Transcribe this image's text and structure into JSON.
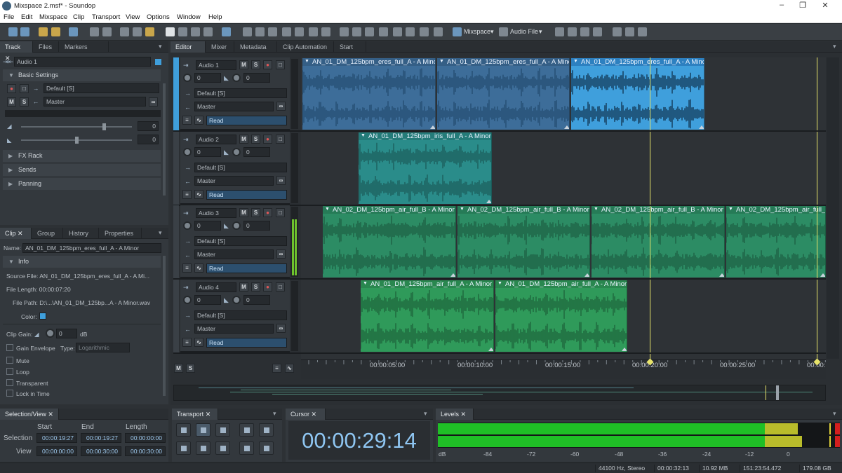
{
  "window": {
    "title": "Mixspace 2.msf* - Soundop"
  },
  "menu": [
    "File",
    "Edit",
    "Mixspace",
    "Clip",
    "Transport",
    "View",
    "Options",
    "Window",
    "Help"
  ],
  "toolbar": {
    "mixspace_label": "Mixspace",
    "audiofile_label": "Audio File"
  },
  "track_panel": {
    "tabs": [
      "Track",
      "Files",
      "Markers"
    ],
    "track_name": "Audio 1",
    "basic_settings": "Basic Settings",
    "input": "Default [S]",
    "output": "Master",
    "vol_value": "0",
    "pan_value": "0",
    "sections": [
      "FX Rack",
      "Sends",
      "Panning"
    ]
  },
  "clip_panel": {
    "tabs": [
      "Clip",
      "Group",
      "History",
      "Properties"
    ],
    "name_label": "Name:",
    "name_value": "AN_01_DM_125bpm_eres_full_A - A Minor",
    "info": "Info",
    "source_file": "Source File: AN_01_DM_125bpm_eres_full_A - A Mi...",
    "file_length": "File Length: 00:00:07:20",
    "file_path": "File Path: D:\\...\\AN_01_DM_125bp...A - A Minor.wav",
    "color_label": "Color:",
    "clip_gain_label": "Clip Gain:",
    "clip_gain_value": "0",
    "clip_gain_unit": "dB",
    "gain_envelope": "Gain Envelope",
    "type_label": "Type:",
    "type_value": "Logarithmic",
    "checks": [
      "Mute",
      "Loop",
      "Transparent",
      "Lock in Time"
    ]
  },
  "editor_tabs": [
    "Editor",
    "Mixer",
    "Metadata",
    "Clip Automation",
    "Start"
  ],
  "tracks": [
    {
      "name": "Audio 1",
      "vol": "0",
      "pan": "0",
      "input": "Default [S]",
      "output": "Master",
      "mode": "Read"
    },
    {
      "name": "Audio 2",
      "vol": "0",
      "pan": "0",
      "input": "Default [S]",
      "output": "Master",
      "mode": "Read"
    },
    {
      "name": "Audio 3",
      "vol": "0",
      "pan": "0",
      "input": "Default [S]",
      "output": "Master",
      "mode": "Read"
    },
    {
      "name": "Audio 4",
      "vol": "0",
      "pan": "0",
      "input": "Default [S]",
      "output": "Master",
      "mode": "Read"
    }
  ],
  "clips": [
    {
      "track": 0,
      "name": "AN_01_DM_125bpm_eres_full_A - A Minor",
      "color": "#3d6d99",
      "dark": "#21496d",
      "sel": false
    },
    {
      "track": 0,
      "name": "AN_01_DM_125bpm_eres_full_A - A Minor",
      "color": "#3d6d99",
      "dark": "#21496d",
      "sel": false
    },
    {
      "track": 0,
      "name": "AN_01_DM_125bpm_eres_full_A - A Minor",
      "color": "#3f9fdc",
      "dark": "#0b2942",
      "sel": true
    },
    {
      "track": 1,
      "name": "AN_01_DM_125bpm_iris_full_A - A Minor",
      "color": "#2a8c8a",
      "dark": "#1b5856",
      "sel": false
    },
    {
      "track": 2,
      "name": "AN_02_DM_125bpm_air_full_B - A Minor",
      "color": "#2c8c64",
      "dark": "#1b5a40",
      "sel": false
    },
    {
      "track": 2,
      "name": "AN_02_DM_125bpm_air_full_B - A Minor",
      "color": "#2c8c64",
      "dark": "#1b5a40",
      "sel": false
    },
    {
      "track": 2,
      "name": "AN_02_DM_125bpm_air_full_B - A Minor",
      "color": "#2c8c64",
      "dark": "#1b5a40",
      "sel": false
    },
    {
      "track": 2,
      "name": "AN_02_DM_125bpm_air_full_B - A Minor",
      "color": "#2c8c64",
      "dark": "#1b5a40",
      "sel": false
    },
    {
      "track": 3,
      "name": "AN_01_DM_125bpm_air_full_A - A Minor",
      "color": "#2f9a5a",
      "dark": "#1c5e38",
      "sel": false
    },
    {
      "track": 3,
      "name": "AN_01_DM_125bpm_air_full_A - A Minor",
      "color": "#2f9a5a",
      "dark": "#1c5e38",
      "sel": false
    }
  ],
  "timeline": [
    "00:00:05:00",
    "00:00:10:00",
    "00:00:15:00",
    "00:00:20:00",
    "00:00:25:00",
    "00:00:"
  ],
  "selection_view": {
    "tab": "Selection/View",
    "headers": [
      "Start",
      "End",
      "Length"
    ],
    "selection_label": "Selection",
    "view_label": "View",
    "selection": [
      "00:00:19:27",
      "00:00:19:27",
      "00:00:00:00"
    ],
    "view": [
      "00:00:00:00",
      "00:00:30:00",
      "00:00:30:00"
    ]
  },
  "transport": {
    "tab": "Transport"
  },
  "cursor": {
    "tab": "Cursor",
    "time": "00:00:29:14"
  },
  "levels": {
    "tab": "Levels",
    "scale": [
      "dB",
      "-84",
      "-72",
      "-60",
      "-48",
      "-36",
      "-24",
      "-12",
      "0"
    ],
    "peak_left_db": -10,
    "peak_right_db": -9
  },
  "status": {
    "format": "44100 Hz, Stereo",
    "length": "00:00:32:13",
    "size": "10.92 MB",
    "free": "151:23:54.472",
    "disk": "179.08 GB"
  }
}
